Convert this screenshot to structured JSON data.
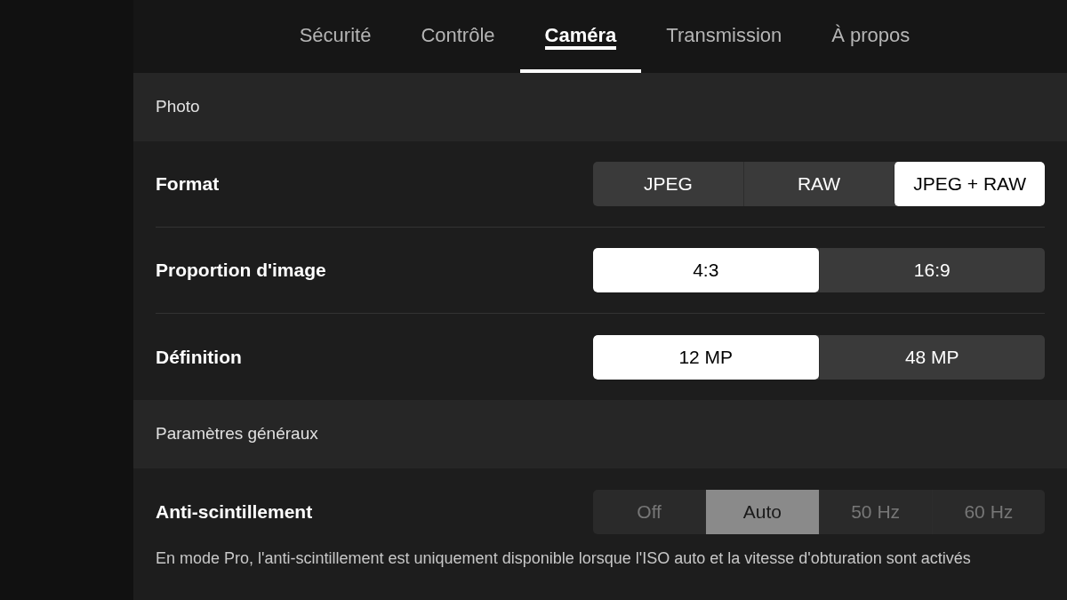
{
  "tabs": [
    {
      "label": "Sécurité",
      "selected": false
    },
    {
      "label": "Contrôle",
      "selected": false
    },
    {
      "label": "Caméra",
      "selected": true
    },
    {
      "label": "Transmission",
      "selected": false
    },
    {
      "label": "À propos",
      "selected": false
    }
  ],
  "sections": [
    {
      "title": "Photo",
      "settings": [
        {
          "label": "Format",
          "disabled": false,
          "options": [
            {
              "label": "JPEG",
              "selected": false
            },
            {
              "label": "RAW",
              "selected": false
            },
            {
              "label": "JPEG + RAW",
              "selected": true
            }
          ]
        },
        {
          "label": "Proportion d'image",
          "disabled": false,
          "options": [
            {
              "label": "4:3",
              "selected": true
            },
            {
              "label": "16:9",
              "selected": false
            }
          ]
        },
        {
          "label": "Définition",
          "disabled": false,
          "options": [
            {
              "label": "12 MP",
              "selected": true
            },
            {
              "label": "48 MP",
              "selected": false
            }
          ]
        }
      ]
    },
    {
      "title": "Paramètres généraux",
      "settings": [
        {
          "label": "Anti-scintillement",
          "disabled": true,
          "note": "En mode Pro, l'anti-scintillement est uniquement disponible lorsque l'ISO auto et la vitesse d'obturation sont activés",
          "options": [
            {
              "label": "Off",
              "selected": false
            },
            {
              "label": "Auto",
              "selected": true
            },
            {
              "label": "50 Hz",
              "selected": false
            },
            {
              "label": "60 Hz",
              "selected": false
            }
          ]
        }
      ]
    }
  ]
}
